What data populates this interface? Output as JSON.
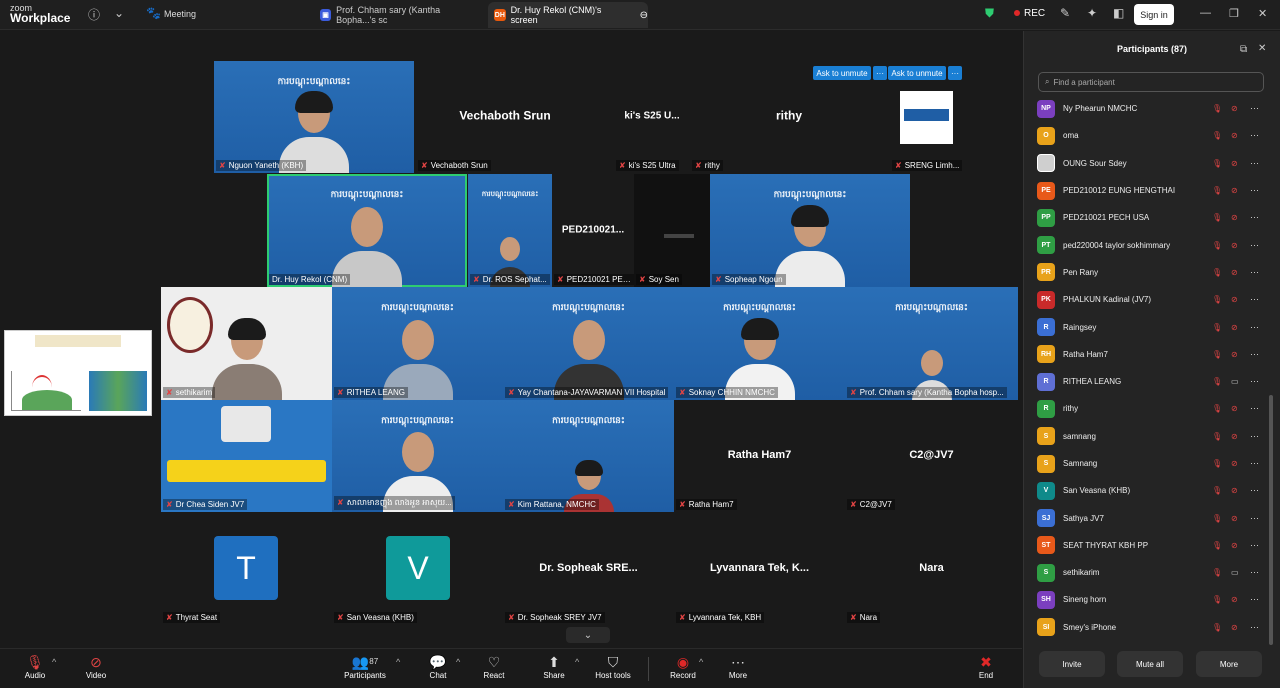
{
  "topbar": {
    "logo_line1": "zoom",
    "logo_line2": "Workplace",
    "meeting_label": "Meeting",
    "tabs": [
      {
        "badge": "",
        "label": "Prof. Chham sary (Kantha Bopha...'s sc",
        "badge_color": "#3b5bdb"
      },
      {
        "badge": "DH",
        "label": "Dr. Huy Rekol (CNM)'s screen",
        "badge_color": "#e8590c"
      }
    ],
    "rec_label": "REC",
    "signin_label": "Sign in"
  },
  "unmute": {
    "label1": "Ask to unmute",
    "label2": "Ask to unmute",
    "more": "···"
  },
  "tiles": {
    "nguon": "Nguon Yaneth (KBH)",
    "vechaboth_big": "Vechaboth Srun",
    "vechaboth": "Vechaboth Srun",
    "ki_big": "ki's S25 U...",
    "ki": "ki's S25 Ultra",
    "rithy_big": "rithy",
    "rithy": "rithy",
    "sreng": "SRENG Limh...",
    "huy": "Dr. Huy Rekol (CNM)",
    "ros": "Dr. ROS Sephat...",
    "ped_big": "PED210021...",
    "ped": "PED210021 PEC...",
    "soy": "Soy Sen",
    "sopheap": "Sopheap Ngoun",
    "sethikarim": "sethikarim",
    "rithea": "RITHEA LEANG",
    "yay": "Yay Chantana-JAYAVARMAN VII Hospital",
    "soknay": "Soknay CHHIN NMCHC",
    "chham": "Prof. Chham sary (Kantha Bopha hosp...",
    "chea": "Dr Chea Siden JV7",
    "khmer_name": "សាលាមានញុង លាងអួន អាសុយ...",
    "kim": "Kim Rattana, NMCHC",
    "ratha_big": "Ratha Ham7",
    "ratha": "Ratha Ham7",
    "c2_big": "C2@JV7",
    "c2": "C2@JV7",
    "thyrat_initial": "T",
    "thyrat": "Thyrat Seat",
    "sanveasna_initial": "V",
    "sanveasna": "San Veasna (KHB)",
    "sopheak_big": "Dr. Sopheak SRE...",
    "sopheak": "Dr. Sopheak SREY JV7",
    "lyvannara_big": "Lyvannara Tek, K...",
    "lyvannara": "Lyvannara Tek, KBH",
    "nara_big": "Nara",
    "nara": "Nara"
  },
  "slide_title": "ការបណ្ដុះបណ្ដាលនេះ",
  "controls": {
    "audio": "Audio",
    "video": "Video",
    "participants": "Participants",
    "participants_count": "87",
    "chat": "Chat",
    "react": "React",
    "share": "Share",
    "host_tools": "Host tools",
    "record": "Record",
    "more": "More",
    "end": "End"
  },
  "panel": {
    "title": "Participants (87)",
    "search_placeholder": "Find a participant",
    "invite": "Invite",
    "mute_all": "Mute all",
    "more": "More",
    "participants": [
      {
        "initials": "NP",
        "name": "Ny Phearun NMCHC",
        "color": "#7b3fbf",
        "video": false
      },
      {
        "initials": "O",
        "name": "oma",
        "color": "#e8a21a",
        "video": false
      },
      {
        "initials": "",
        "name": "OUNG Sour Sdey",
        "color": "#cfcfcf",
        "video": false
      },
      {
        "initials": "PE",
        "name": "PED210012 EUNG HENGTHAI",
        "color": "#e8591a",
        "video": false
      },
      {
        "initials": "PP",
        "name": "PED210021 PECH USA",
        "color": "#2f9e44",
        "video": false
      },
      {
        "initials": "PT",
        "name": "ped220004 taylor sokhimmary",
        "color": "#2f9e44",
        "video": false
      },
      {
        "initials": "PR",
        "name": "Pen Rany",
        "color": "#e8a21a",
        "video": false
      },
      {
        "initials": "PK",
        "name": "PHALKUN Kadinal (JV7)",
        "color": "#c92a2a",
        "video": false
      },
      {
        "initials": "R",
        "name": "Raingsey",
        "color": "#3b6fd4",
        "video": false
      },
      {
        "initials": "RH",
        "name": "Ratha Ham7",
        "color": "#e8a21a",
        "video": false
      },
      {
        "initials": "R",
        "name": "RITHEA LEANG",
        "color": "#5f6fd4",
        "video": true
      },
      {
        "initials": "R",
        "name": "rithy",
        "color": "#2f9e44",
        "video": false
      },
      {
        "initials": "S",
        "name": "samnang",
        "color": "#e8a21a",
        "video": false
      },
      {
        "initials": "S",
        "name": "Samnang",
        "color": "#e8a21a",
        "video": false
      },
      {
        "initials": "V",
        "name": "San Veasna (KHB)",
        "color": "#0f8a8a",
        "video": false
      },
      {
        "initials": "SJ",
        "name": "Sathya JV7",
        "color": "#3b6fd4",
        "video": false
      },
      {
        "initials": "ST",
        "name": "SEAT THYRAT KBH PP",
        "color": "#e8591a",
        "video": false
      },
      {
        "initials": "S",
        "name": "sethikarim",
        "color": "#2f9e44",
        "video": true
      },
      {
        "initials": "SH",
        "name": "Sineng horn",
        "color": "#7b3fbf",
        "video": false
      },
      {
        "initials": "SI",
        "name": "Smey's iPhone",
        "color": "#e8a21a",
        "video": false
      }
    ]
  }
}
